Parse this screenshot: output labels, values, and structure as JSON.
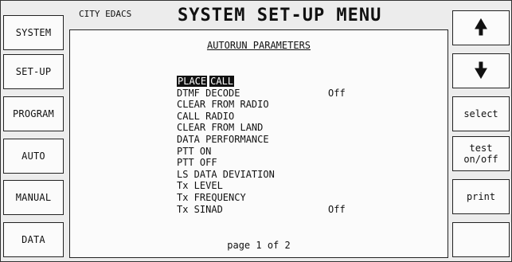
{
  "header": {
    "city": "CITY EDACS",
    "title": "SYSTEM SET-UP MENU"
  },
  "left_keys": [
    "SYSTEM",
    "SET-UP",
    "PROGRAM",
    "AUTO",
    "MANUAL",
    "DATA"
  ],
  "right_keys": {
    "up": "up-arrow-icon",
    "down": "down-arrow-icon",
    "select": "select",
    "test_line1": "test",
    "test_line2": "on/off",
    "print": "print",
    "blank": ""
  },
  "panel": {
    "subtitle": "AUTORUN PARAMETERS",
    "selected_word1": "PLACE",
    "selected_word2": "CALL",
    "params": [
      {
        "label": "DTMF DECODE",
        "value": "Off"
      },
      {
        "label": "CLEAR FROM RADIO",
        "value": ""
      },
      {
        "label": "CALL RADIO",
        "value": ""
      },
      {
        "label": "CLEAR FROM LAND",
        "value": ""
      },
      {
        "label": "DATA PERFORMANCE",
        "value": ""
      },
      {
        "label": "PTT ON",
        "value": ""
      },
      {
        "label": "PTT OFF",
        "value": ""
      },
      {
        "label": "LS DATA DEVIATION",
        "value": ""
      },
      {
        "label": "Tx LEVEL",
        "value": ""
      },
      {
        "label": "Tx FREQUENCY",
        "value": ""
      },
      {
        "label": "Tx SINAD",
        "value": "Off"
      }
    ],
    "page_indicator": "page 1 of 2"
  }
}
